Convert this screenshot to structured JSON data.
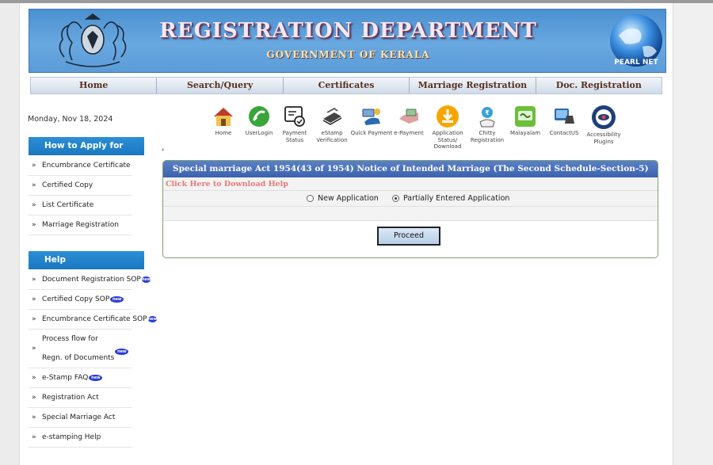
{
  "banner": {
    "title": "REGISTRATION DEPARTMENT",
    "subtitle": "GOVERNMENT OF KERALA",
    "globe_text": "PEARL NET"
  },
  "nav": [
    "Home",
    "Search/Query",
    "Certificates",
    "Marriage Registration",
    "Doc. Registration"
  ],
  "date": "Monday, Nov 18, 2024",
  "how_to_apply": {
    "heading": "How to Apply for",
    "items": [
      "Encumbrance Certificate",
      "Certified Copy",
      "List Certificate",
      "Marriage Registration"
    ]
  },
  "help": {
    "heading": "Help",
    "items": [
      {
        "label": "Document Registration SOP",
        "new": true
      },
      {
        "label": "Certified Copy SOP",
        "new": true
      },
      {
        "label": "Encumbrance Certificate SOP",
        "new": true
      },
      {
        "label": "Process flow for",
        "label2": "Regn. of Documents",
        "new": true
      },
      {
        "label": "e-Stamp FAQ",
        "new": true
      },
      {
        "label": "Registration Act",
        "new": false
      },
      {
        "label": "Special Marriage Act",
        "new": false
      },
      {
        "label": "e-stamping Help",
        "new": false
      }
    ],
    "new_badge": "new"
  },
  "icons": [
    {
      "label": "Home",
      "icon": "home-icon"
    },
    {
      "label": "UserLogin",
      "icon": "user-login-icon"
    },
    {
      "label": "Payment Status",
      "icon": "payment-status-icon"
    },
    {
      "label": "eStamp Verification",
      "icon": "estamp-verification-icon"
    },
    {
      "label": "Quick Payment",
      "icon": "quick-payment-icon"
    },
    {
      "label": "e-Payment",
      "icon": "e-payment-icon"
    },
    {
      "label": "Application Status/ Download",
      "icon": "application-status-download-icon"
    },
    {
      "label": "Chitty Registration",
      "icon": "chitty-registration-icon"
    },
    {
      "label": "Malayalam",
      "icon": "malayalam-icon"
    },
    {
      "label": "ContactUS",
      "icon": "contact-us-icon"
    },
    {
      "label": "Accessibility Plugins",
      "icon": "accessibility-plugins-icon"
    }
  ],
  "form": {
    "title": "Special marriage Act 1954(43 of 1954) Notice of Intended Marriage (The Second Schedule-Section-5)",
    "download_help": "Click Here to Download Help",
    "options": [
      {
        "label": "New Application",
        "selected": false
      },
      {
        "label": "Partially Entered Application",
        "selected": true
      }
    ],
    "proceed_label": "Proceed"
  },
  "colors": {
    "banner": "#5b9bd8",
    "side_heading": "#1a78c0",
    "panel_title": "#3c62ae",
    "download_link": "#e87878"
  }
}
